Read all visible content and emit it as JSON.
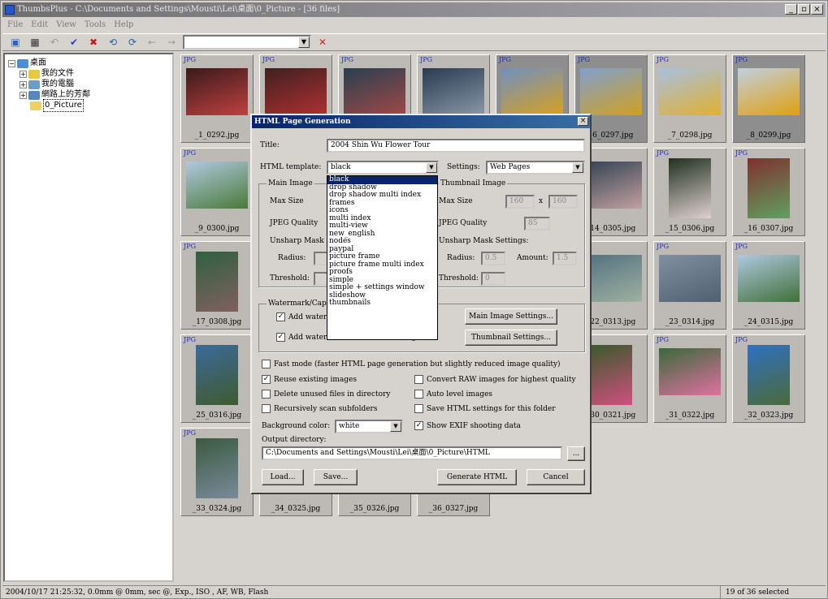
{
  "window": {
    "title": "ThumbsPlus - C:\\Documents and Settings\\Mousti\\Lei\\桌面\\0_Picture - [36 files]",
    "controls": [
      "_",
      "▫",
      "×"
    ]
  },
  "menubar": [
    "File",
    "Edit",
    "View",
    "Tools",
    "Help"
  ],
  "toolbar": {
    "icons": [
      "open-icon",
      "view-icon",
      "back-icon",
      "check-icon",
      "delete-icon",
      "rotate-left-icon",
      "rotate-right-icon",
      "nav-back-icon",
      "nav-forward-icon",
      "stop-icon"
    ],
    "path_value": ""
  },
  "tree": [
    {
      "label": "桌面",
      "indent": 0,
      "icon": "desktop-icon",
      "color": "#4a8fd6"
    },
    {
      "label": "我的文件",
      "indent": 1,
      "icon": "folder-icon",
      "color": "#e8c840"
    },
    {
      "label": "我的電腦",
      "indent": 1,
      "icon": "computer-icon",
      "color": "#6a9ec8"
    },
    {
      "label": "網路上的芳鄰",
      "indent": 1,
      "icon": "network-icon",
      "color": "#5a86c0"
    },
    {
      "label": "0_Picture",
      "indent": 1,
      "icon": "folder-open-icon",
      "color": "#f0d060",
      "selected": true
    }
  ],
  "thumbnails": [
    {
      "tag": "JPG",
      "name": "_1_0292.jpg",
      "colors": [
        "#3a1a1a",
        "#c04040"
      ],
      "tall": false
    },
    {
      "tag": "JPG",
      "name": "",
      "colors": [
        "#402020",
        "#b03030"
      ],
      "tall": false
    },
    {
      "tag": "JPG",
      "name": "",
      "colors": [
        "#284050",
        "#a04848"
      ],
      "tall": false
    },
    {
      "tag": "JPG",
      "name": "",
      "colors": [
        "#2a3a50",
        "#8898a8"
      ],
      "tall": false
    },
    {
      "tag": "JPG",
      "name": "",
      "colors": [
        "#7090c0",
        "#d8a020"
      ],
      "tall": false
    },
    {
      "tag": "JPG",
      "name": "_6_0297.jpg",
      "colors": [
        "#80a0d0",
        "#d0a020"
      ],
      "tall": false
    },
    {
      "tag": "JPG",
      "name": "_7_0298.jpg",
      "colors": [
        "#a8c0e0",
        "#e0b030"
      ],
      "tall": false
    },
    {
      "tag": "JPG",
      "name": "_8_0299.jpg",
      "colors": [
        "#c0d0e0",
        "#e0a010"
      ],
      "tall": false
    },
    {
      "tag": "JPG",
      "name": "_9_0300.jpg",
      "colors": [
        "#b0c8e0",
        "#4a7a3a"
      ],
      "tall": false
    },
    {
      "tag": "JPG",
      "name": "",
      "colors": [
        "#555",
        "#777"
      ],
      "tall": false
    },
    {
      "tag": "JPG",
      "name": "",
      "colors": [
        "#555",
        "#777"
      ],
      "tall": false
    },
    {
      "tag": "JPG",
      "name": "",
      "colors": [
        "#555",
        "#777"
      ],
      "tall": false
    },
    {
      "tag": "JPG",
      "name": "",
      "colors": [
        "#555",
        "#777"
      ],
      "tall": false
    },
    {
      "tag": "JPG",
      "name": "_14_0305.jpg",
      "colors": [
        "#304050",
        "#c0a0a0"
      ],
      "tall": false
    },
    {
      "tag": "JPG",
      "name": "_15_0306.jpg",
      "colors": [
        "#203020",
        "#e0d0d0"
      ],
      "tall": true
    },
    {
      "tag": "JPG",
      "name": "_16_0307.jpg",
      "colors": [
        "#803030",
        "#60a060"
      ],
      "tall": true
    },
    {
      "tag": "JPG",
      "name": "_17_0308.jpg",
      "colors": [
        "#306040",
        "#806060"
      ],
      "tall": true
    },
    {
      "tag": "JPG",
      "name": "",
      "colors": [
        "#555",
        "#777"
      ],
      "tall": false
    },
    {
      "tag": "JPG",
      "name": "",
      "colors": [
        "#555",
        "#777"
      ],
      "tall": false
    },
    {
      "tag": "JPG",
      "name": "",
      "colors": [
        "#555",
        "#777"
      ],
      "tall": false
    },
    {
      "tag": "JPG",
      "name": "",
      "colors": [
        "#555",
        "#777"
      ],
      "tall": false
    },
    {
      "tag": "JPG",
      "name": "_22_0313.jpg",
      "colors": [
        "#507080",
        "#a0b0a0"
      ],
      "tall": false
    },
    {
      "tag": "JPG",
      "name": "_23_0314.jpg",
      "colors": [
        "#8090a0",
        "#506070"
      ],
      "tall": false
    },
    {
      "tag": "JPG",
      "name": "_24_0315.jpg",
      "colors": [
        "#b0c8e0",
        "#40703a"
      ],
      "tall": false
    },
    {
      "tag": "JPG",
      "name": "_25_0316.jpg",
      "colors": [
        "#3a6a9a",
        "#405a30"
      ],
      "tall": true
    },
    {
      "tag": "JPG",
      "name": "",
      "colors": [
        "#555",
        "#777"
      ],
      "tall": false
    },
    {
      "tag": "JPG",
      "name": "",
      "colors": [
        "#555",
        "#777"
      ],
      "tall": false
    },
    {
      "tag": "JPG",
      "name": "",
      "colors": [
        "#555",
        "#777"
      ],
      "tall": false
    },
    {
      "tag": "JPG",
      "name": "",
      "colors": [
        "#555",
        "#777"
      ],
      "tall": false
    },
    {
      "tag": "JPG",
      "name": "_30_0321.jpg",
      "colors": [
        "#3a5a2a",
        "#d05080"
      ],
      "tall": true
    },
    {
      "tag": "JPG",
      "name": "_31_0322.jpg",
      "colors": [
        "#3a6a3a",
        "#e070a0"
      ],
      "tall": false
    },
    {
      "tag": "JPG",
      "name": "_32_0323.jpg",
      "colors": [
        "#3070c0",
        "#4a6a3a"
      ],
      "tall": true
    },
    {
      "tag": "JPG",
      "name": "_33_0324.jpg",
      "colors": [
        "#3a5a40",
        "#7a8a9a"
      ],
      "tall": true
    },
    {
      "tag": "",
      "name": "_34_0325.jpg",
      "colors": [
        "#888",
        "#999"
      ],
      "tall": false
    },
    {
      "tag": "",
      "name": "_35_0326.jpg",
      "colors": [
        "#2a4a6a",
        "#507060"
      ],
      "tall": false
    },
    {
      "tag": "",
      "name": "_36_0327.jpg",
      "colors": [
        "#3a5a5a",
        "#6a8a8a"
      ],
      "tall": false
    }
  ],
  "status": {
    "info": "2004/10/17 21:25:32, 0.0mm @ 0mm, sec @, Exp., ISO , AF, WB, Flash",
    "count": "19 of 36 selected"
  },
  "dialog": {
    "title": "HTML Page Generation",
    "title_label": "Title:",
    "title_value": "2004 Shin Wu Flower Tour",
    "template_label": "HTML template:",
    "template_value": "black",
    "settings_label": "Settings:",
    "settings_value": "Web Pages",
    "main_image_group": "Main Image",
    "thumb_group": "Thumbnail Image",
    "max_size": "Max Size",
    "jpeg_quality": "JPEG Quality",
    "unsharp_mask": "Unsharp Mask Settings:",
    "radius": "Radius:",
    "amount": "Amount:",
    "threshold": "Threshold:",
    "thumb_max_w": "160",
    "thumb_max_h": "160",
    "thumb_quality": "85",
    "thumb_radius": "0.5",
    "thumb_amount": "1.5",
    "thumb_threshold": "0",
    "x_sep": "x",
    "watermark_group": "Watermark/Caption",
    "add_wm_1": "Add watermark to main image",
    "add_wm_2": "Add watermark to thumbnail image",
    "main_settings_btn": "Main Image Settings...",
    "thumb_settings_btn": "Thumbnail Settings...",
    "fast_mode": "Fast mode (faster HTML page generation but slightly reduced image quality)",
    "reuse_images": "Reuse existing images",
    "convert_raw": "Convert RAW images for highest quality",
    "delete_unused": "Delete unused files in directory",
    "auto_level": "Auto level images",
    "recursive": "Recursively scan subfolders",
    "save_settings": "Save HTML settings for this folder",
    "bg_label": "Background color:",
    "bg_value": "white",
    "show_exif": "Show EXIF shooting data",
    "output_label": "Output directory:",
    "output_value": "C:\\Documents and Settings\\Mousti\\Lei\\桌面\\0_Picture\\HTML",
    "browse_btn": "...",
    "load_btn": "Load...",
    "save_btn": "Save...",
    "generate_btn": "Generate HTML",
    "cancel_btn": "Cancel",
    "close": "×"
  },
  "template_options": [
    "black",
    "drop shadow",
    "drop shadow multi index",
    "frames",
    "icons",
    "multi index",
    "multi-view",
    "new_english",
    "nodes",
    "paypal",
    "picture frame",
    "picture frame multi index",
    "proofs",
    "simple",
    "simple + settings window",
    "slideshow",
    "thumbnails"
  ]
}
